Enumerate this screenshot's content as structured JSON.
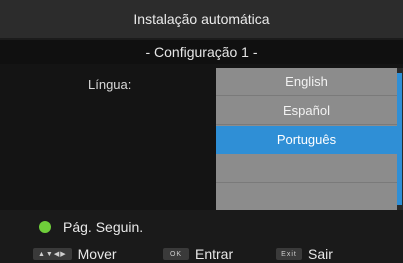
{
  "header": {
    "title": "Instalação automática",
    "subtitle": "- Configuração 1 -"
  },
  "form": {
    "language_label": "Língua:",
    "languages": [
      {
        "label": "English",
        "selected": false
      },
      {
        "label": "Español",
        "selected": false
      },
      {
        "label": "Português",
        "selected": true
      },
      {
        "label": "",
        "selected": false
      },
      {
        "label": "",
        "selected": false
      }
    ]
  },
  "footer": {
    "next_page_label": "Pág. Seguin.",
    "move_key": "▲▼◀▶",
    "move_label": "Mover",
    "ok_key": "OK",
    "enter_label": "Entrar",
    "exit_key": "Exit",
    "exit_label": "Sair"
  },
  "colors": {
    "accent": "#2f8fd6",
    "next_page_dot": "#6fce3a",
    "list_background": "#8c8c8c"
  },
  "icons": {
    "next_page": "green-dot-icon",
    "move": "arrow-keys-icon",
    "ok": "ok-key-icon",
    "exit": "exit-key-icon"
  }
}
